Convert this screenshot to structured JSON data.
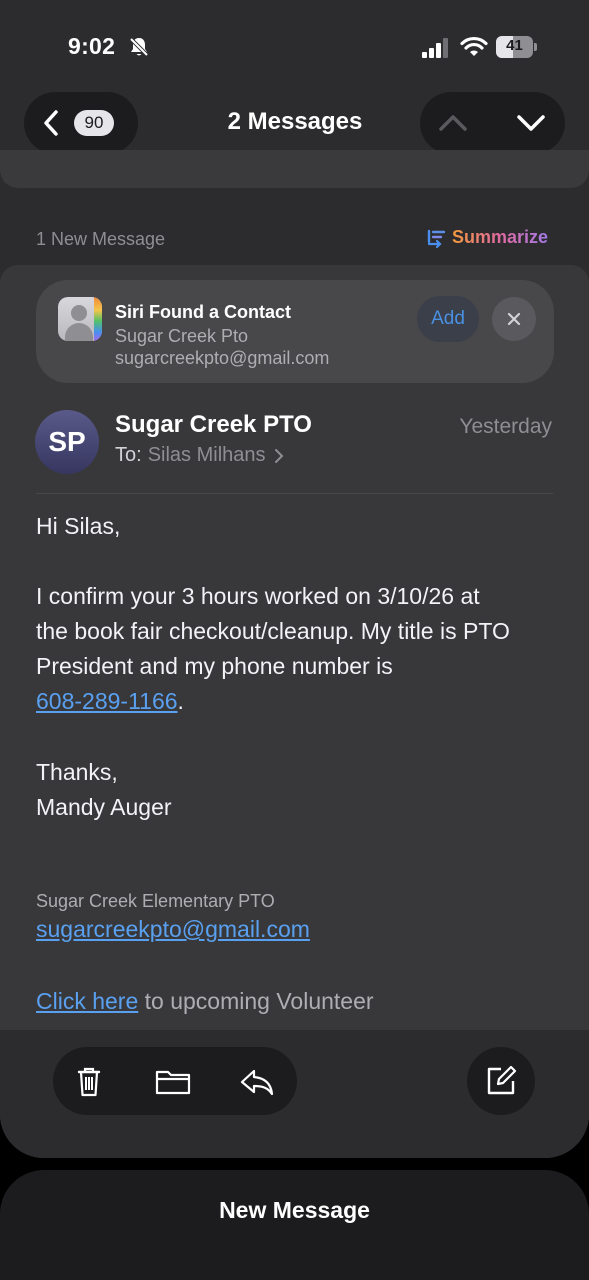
{
  "status_bar": {
    "time": "9:02",
    "battery": "41"
  },
  "nav": {
    "back_count": "90",
    "title": "2 Messages"
  },
  "thread": {
    "new_message_label": "1 New Message",
    "summarize_label": "Summarize"
  },
  "siri_suggestion": {
    "title": "Siri Found a Contact",
    "name": "Sugar Creek Pto",
    "email": "sugarcreekpto@gmail.com",
    "add_label": "Add"
  },
  "message": {
    "avatar_initials": "SP",
    "sender": "Sugar Creek PTO",
    "to_label": "To:",
    "recipient": "Silas Milhans",
    "date": "Yesterday",
    "greeting": "Hi Silas,",
    "body_line1": "I confirm your 3 hours worked on 3/10/26 at",
    "body_line2": "the book fair checkout/cleanup. My title is PTO",
    "body_line3": "President and my phone number is",
    "phone": "608-289-1166",
    "phone_suffix": ".",
    "closing": "Thanks,",
    "signer": "Mandy Auger",
    "signature_org": "Sugar Creek Elementary PTO",
    "signature_email": "sugarcreekpto@gmail.com",
    "click_link": "Click here",
    "click_rest": " to upcoming Volunteer"
  },
  "bottom_sheet": {
    "title": "New Message"
  },
  "icons": {
    "bell": "bell-slash-icon",
    "signal": "cellular-signal-icon",
    "wifi": "wifi-icon",
    "back": "chevron-left-icon",
    "up": "chevron-up-icon",
    "down": "chevron-down-icon",
    "summarize": "summarize-icon",
    "contact": "contact-card-icon",
    "close": "close-icon",
    "trash": "trash-icon",
    "folder": "folder-icon",
    "reply": "reply-icon",
    "compose": "compose-icon"
  },
  "colors": {
    "link": "#5aa0f0",
    "add_button_text": "#4a90e2",
    "background": "#2c2c2e"
  }
}
